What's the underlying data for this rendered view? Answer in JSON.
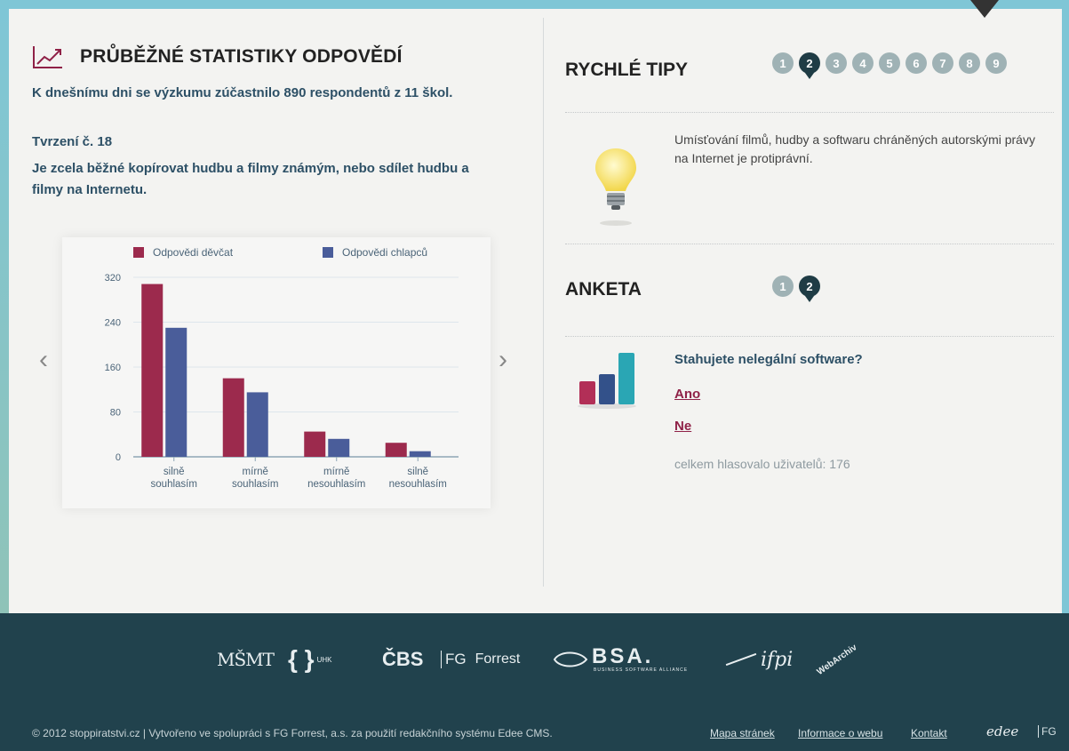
{
  "stats": {
    "title": "PRŮBĚŽNÉ STATISTIKY ODPOVĚDÍ",
    "subtitle": "K dnešnímu dni se výzkumu zúčastnilo 890 respondentů z 11 škol.",
    "claim_label": "Tvrzení č. 18",
    "claim_text": "Je zcela běžné kopírovat hudbu a filmy známým, nebo sdílet hudbu a filmy na Internetu.",
    "prev_arrow": "‹",
    "next_arrow": "›"
  },
  "chart_data": {
    "type": "bar",
    "categories": [
      [
        "silně",
        "souhlasím"
      ],
      [
        "mírně",
        "souhlasím"
      ],
      [
        "mírně",
        "nesouhlasím"
      ],
      [
        "silně",
        "nesouhlasím"
      ]
    ],
    "series": [
      {
        "name": "Odpovědi děvčat",
        "color": "#9c2a4d",
        "values": [
          308,
          140,
          45,
          25
        ]
      },
      {
        "name": "Odpovědi chlapců",
        "color": "#4a5d9a",
        "values": [
          230,
          115,
          32,
          10
        ]
      }
    ],
    "ylim": [
      0,
      320
    ],
    "yticks": [
      0,
      80,
      160,
      240,
      320
    ],
    "grid": true,
    "legend": "top"
  },
  "tips": {
    "title": "RYCHLÉ TIPY",
    "pages": [
      "1",
      "2",
      "3",
      "4",
      "5",
      "6",
      "7",
      "8",
      "9"
    ],
    "active_page": "2",
    "text": "Umísťování filmů, hudby a softwaru chráněných autorskými právy na Internet je protiprávní."
  },
  "poll": {
    "title": "ANKETA",
    "pages": [
      "1",
      "2"
    ],
    "active_page": "2",
    "question": "Stahujete nelegální software?",
    "option_yes": "Ano",
    "option_no": "Ne",
    "total": "celkem hlasovalo uživatelů: 176"
  },
  "footer": {
    "copyright": "© 2012 stoppiratstvi.cz | Vytvořeno ve spolupráci s FG Forrest, a.s. za použití redakčního systému Edee CMS.",
    "links": [
      "Mapa stránek",
      "Informace o webu",
      "Kontakt"
    ],
    "logos": {
      "mkmt": "MŠMT",
      "uhk_braces": "{ }",
      "uhk": "UHK",
      "cbs": "ČBS",
      "fg": "FG",
      "forrest": "Forrest",
      "bsa": "BSA.",
      "bsa_sub": "BUSINESS SOFTWARE ALLIANCE",
      "ifpi": "ifpi",
      "webarchitekt": "WebArchiv",
      "edee": "edee",
      "fg_small": "FG"
    }
  },
  "colors": {
    "accent_dark": "#1f3c45",
    "pager_inactive": "#9fb2b5",
    "link": "#8f2147",
    "footer_bg": "#21424d",
    "top_border": "#7fc6d6"
  }
}
